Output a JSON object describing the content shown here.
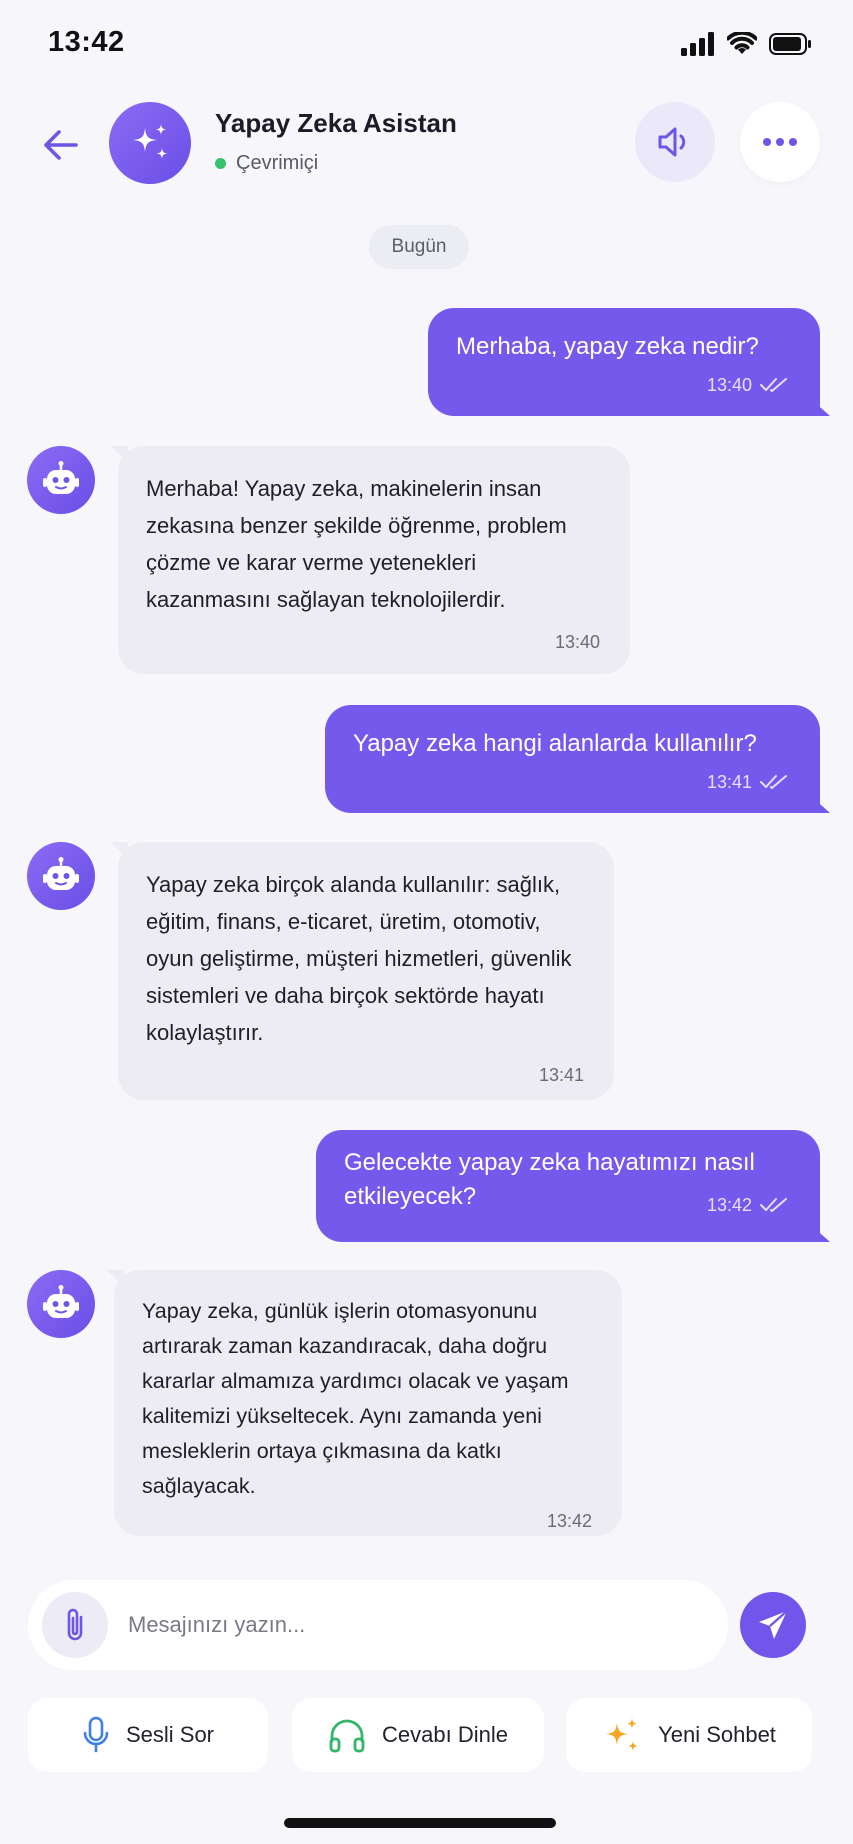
{
  "status_bar": {
    "time": "13:42"
  },
  "header": {
    "title": "Yapay Zeka Asistan",
    "status": "Çevrimiçi"
  },
  "date_chip": "Bugün",
  "messages": [
    {
      "role": "user",
      "text": "Merhaba, yapay zeka nedir?",
      "time": "13:40"
    },
    {
      "role": "bot",
      "text": "Merhaba! Yapay zeka, makinelerin insan zekasına benzer şekilde öğrenme, problem çözme ve karar verme yetenekleri kazanmasını sağlayan teknolojilerdir.",
      "time": "13:40"
    },
    {
      "role": "user",
      "text": "Yapay zeka hangi alanlarda kullanılır?",
      "time": "13:41"
    },
    {
      "role": "bot",
      "text": "Yapay zeka birçok alanda kullanılır: sağlık, eğitim, finans, e-ticaret, üretim, otomotiv, oyun geliştirme, müşteri hizmetleri, güvenlik sistemleri ve daha birçok sektörde hayatı kolaylaştırır.",
      "time": "13:41"
    },
    {
      "role": "user",
      "text": "Gelecekte yapay zeka hayatımızı nasıl etkileyecek?",
      "time": "13:42"
    },
    {
      "role": "bot",
      "text": "Yapay zeka, günlük işlerin otomasyonunu artırarak zaman kazandıracak, daha doğru kararlar almamıza yardımcı olacak ve yaşam kalitemizi yükseltecek. Aynı zamanda yeni mesleklerin ortaya çıkmasına da katkı sağlayacak.",
      "time": "13:42"
    }
  ],
  "composer": {
    "placeholder": "Mesajınızı yazın..."
  },
  "quick_actions": [
    {
      "label": "Sesli Sor",
      "icon": "microphone-icon"
    },
    {
      "label": "Cevabı Dinle",
      "icon": "headphones-icon"
    },
    {
      "label": "Yeni Sohbet",
      "icon": "sparkles-icon"
    }
  ],
  "colors": {
    "accent": "#7559ec",
    "online": "#34c26b",
    "bot_bubble": "#ececf2",
    "background": "#f6f6fb"
  }
}
